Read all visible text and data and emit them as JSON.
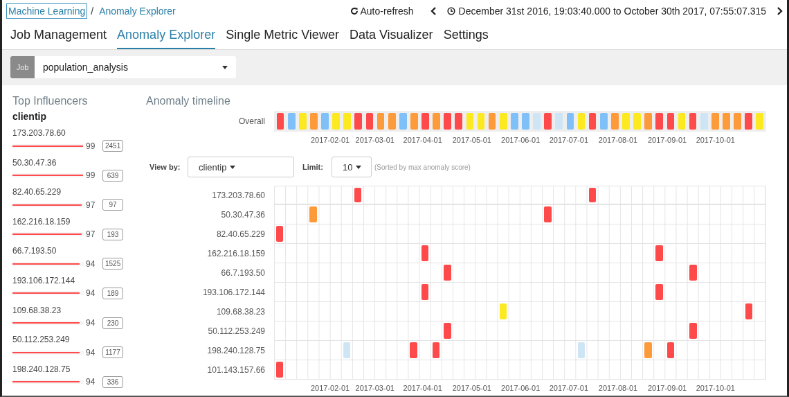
{
  "breadcrumbs": [
    {
      "label": "Machine Learning",
      "focused": true
    },
    {
      "label": "Anomaly Explorer",
      "focused": false
    }
  ],
  "breadcrumb_separator": "/",
  "toolbar": {
    "refresh": "Auto-refresh",
    "time_range": "December 31st 2016, 19:03:40.000 to October 30th 2017, 07:55:07.315"
  },
  "tabs": [
    {
      "label": "Job Management",
      "selected": false
    },
    {
      "label": "Anomaly Explorer",
      "selected": true
    },
    {
      "label": "Single Metric Viewer",
      "selected": false
    },
    {
      "label": "Data Visualizer",
      "selected": false
    },
    {
      "label": "Settings",
      "selected": false
    }
  ],
  "job": {
    "label": "Job",
    "value": "population_analysis"
  },
  "influencers": {
    "title": "Top Influencers",
    "field": "clientip",
    "items": [
      {
        "name": "173.203.78.60",
        "score": "99",
        "level": 0.99,
        "count": "2451"
      },
      {
        "name": "50.30.47.36",
        "score": "99",
        "level": 0.99,
        "count": "639"
      },
      {
        "name": "82.40.65.229",
        "score": "97",
        "level": 0.97,
        "count": "97"
      },
      {
        "name": "162.216.18.159",
        "score": "97",
        "level": 0.97,
        "count": "193"
      },
      {
        "name": "66.7.193.50",
        "score": "94",
        "level": 0.94,
        "count": "1525"
      },
      {
        "name": "193.106.172.144",
        "score": "94",
        "level": 0.94,
        "count": "189"
      },
      {
        "name": "109.68.38.23",
        "score": "94",
        "level": 0.94,
        "count": "230"
      },
      {
        "name": "50.112.253.249",
        "score": "94",
        "level": 0.94,
        "count": "1177"
      },
      {
        "name": "198.240.128.75",
        "score": "94",
        "level": 0.94,
        "count": "336"
      }
    ]
  },
  "timeline": {
    "title": "Anomaly timeline",
    "overall_label": "Overall",
    "overall": [
      {
        "color": "#fe4a4a"
      },
      {
        "color": "#80c0f8"
      },
      {
        "color": "#fde91f"
      },
      {
        "color": "#fd9a3a"
      },
      {
        "color": "#80c0f8"
      },
      {
        "color": "#fde91f"
      },
      {
        "color": "#fde91f"
      },
      {
        "color": "#fe4a4a"
      },
      {
        "color": "#fe4a4a"
      },
      {
        "color": "#fd9a3a"
      },
      {
        "color": "#fd9a3a"
      },
      {
        "color": "#80c0f8"
      },
      {
        "color": "#fd9a3a"
      },
      {
        "color": "#fe4a4a"
      },
      {
        "color": "#fd9a3a"
      },
      {
        "color": "#fe4a4a"
      },
      {
        "color": "#fe4a4a"
      },
      {
        "color": "#fde91f"
      },
      {
        "color": "#fde91f"
      },
      {
        "color": "#fd9a3a"
      },
      {
        "color": "#fde91f"
      },
      {
        "color": "#80c0f8"
      },
      {
        "color": "#80c0f8"
      },
      {
        "color": "#cde5f5"
      },
      {
        "color": "#fe4a4a"
      },
      {
        "color": "#cde5f5"
      },
      {
        "color": "#80c0f8"
      },
      {
        "color": "#fde91f"
      },
      {
        "color": "#fe4a4a"
      },
      {
        "color": "#80c0f8"
      },
      {
        "color": "#fd9a3a"
      },
      {
        "color": "#fde91f"
      },
      {
        "color": "#fde91f"
      },
      {
        "color": "#fd9a3a"
      },
      {
        "color": "#fe4a4a"
      },
      {
        "color": "#fe4a4a"
      },
      {
        "color": "#fde91f"
      },
      {
        "color": "#fe4a4a"
      },
      {
        "color": "#cde5f5"
      },
      {
        "color": "#fd9a3a"
      },
      {
        "color": "#fd9a3a"
      },
      {
        "color": "#fd9a3a"
      },
      {
        "color": "#fe4a4a"
      },
      {
        "color": "#fde91f"
      }
    ],
    "axis": [
      "2017-02-01",
      "2017-03-01",
      "2017-04-01",
      "2017-05-01",
      "2017-06-01",
      "2017-07-01",
      "2017-08-01",
      "2017-09-01",
      "2017-10-01"
    ],
    "view_by": {
      "label": "View by:",
      "value": "clientip"
    },
    "limit": {
      "label": "Limit:",
      "value": "10"
    },
    "sort_note": "(Sorted by max anomaly score)",
    "rows": [
      {
        "label": "173.203.78.60",
        "cells": [
          null,
          null,
          null,
          null,
          null,
          null,
          null,
          {
            "color": "#fe4a4a"
          },
          null,
          null,
          null,
          null,
          null,
          null,
          null,
          null,
          null,
          null,
          null,
          null,
          null,
          null,
          null,
          null,
          null,
          null,
          null,
          null,
          {
            "color": "#fe4a4a"
          },
          null,
          null,
          null,
          null,
          null,
          null,
          null,
          null,
          null,
          null,
          null,
          null,
          null,
          null,
          null
        ]
      },
      {
        "label": "50.30.47.36",
        "cells": [
          null,
          null,
          null,
          {
            "color": "#fd9a3a"
          },
          null,
          null,
          null,
          null,
          null,
          null,
          null,
          null,
          null,
          null,
          null,
          null,
          null,
          null,
          null,
          null,
          null,
          null,
          null,
          null,
          {
            "color": "#fe4a4a"
          },
          null,
          null,
          null,
          null,
          null,
          null,
          null,
          null,
          null,
          null,
          null,
          null,
          null,
          null,
          null,
          null,
          null,
          null,
          null
        ]
      },
      {
        "label": "82.40.65.229",
        "cells": [
          {
            "color": "#fe4a4a"
          },
          null,
          null,
          null,
          null,
          null,
          null,
          null,
          null,
          null,
          null,
          null,
          null,
          null,
          null,
          null,
          null,
          null,
          null,
          null,
          null,
          null,
          null,
          null,
          null,
          null,
          null,
          null,
          null,
          null,
          null,
          null,
          null,
          null,
          null,
          null,
          null,
          null,
          null,
          null,
          null,
          null,
          null,
          null
        ]
      },
      {
        "label": "162.216.18.159",
        "cells": [
          null,
          null,
          null,
          null,
          null,
          null,
          null,
          null,
          null,
          null,
          null,
          null,
          null,
          {
            "color": "#fe4a4a"
          },
          null,
          null,
          null,
          null,
          null,
          null,
          null,
          null,
          null,
          null,
          null,
          null,
          null,
          null,
          null,
          null,
          null,
          null,
          null,
          null,
          {
            "color": "#fe4a4a"
          },
          null,
          null,
          null,
          null,
          null,
          null,
          null,
          null,
          null
        ]
      },
      {
        "label": "66.7.193.50",
        "cells": [
          null,
          null,
          null,
          null,
          null,
          null,
          null,
          null,
          null,
          null,
          null,
          null,
          null,
          null,
          null,
          {
            "color": "#fe4a4a"
          },
          null,
          null,
          null,
          null,
          null,
          null,
          null,
          null,
          null,
          null,
          null,
          null,
          null,
          null,
          null,
          null,
          null,
          null,
          null,
          null,
          null,
          {
            "color": "#fe4a4a"
          },
          null,
          null,
          null,
          null,
          null,
          null
        ]
      },
      {
        "label": "193.106.172.144",
        "cells": [
          null,
          null,
          null,
          null,
          null,
          null,
          null,
          null,
          null,
          null,
          null,
          null,
          null,
          {
            "color": "#fe4a4a"
          },
          null,
          null,
          null,
          null,
          null,
          null,
          null,
          null,
          null,
          null,
          null,
          null,
          null,
          null,
          null,
          null,
          null,
          null,
          null,
          null,
          {
            "color": "#fe4a4a"
          },
          null,
          null,
          null,
          null,
          null,
          null,
          null,
          null,
          null
        ]
      },
      {
        "label": "109.68.38.23",
        "cells": [
          null,
          null,
          null,
          null,
          null,
          null,
          null,
          null,
          null,
          null,
          null,
          null,
          null,
          null,
          null,
          null,
          null,
          null,
          null,
          null,
          {
            "color": "#fde91f"
          },
          null,
          null,
          null,
          null,
          null,
          null,
          null,
          null,
          null,
          null,
          null,
          null,
          null,
          null,
          null,
          null,
          null,
          null,
          null,
          null,
          null,
          {
            "color": "#fe4a4a"
          },
          null
        ]
      },
      {
        "label": "50.112.253.249",
        "cells": [
          null,
          null,
          null,
          null,
          null,
          null,
          null,
          null,
          null,
          null,
          null,
          null,
          null,
          null,
          null,
          {
            "color": "#fe4a4a"
          },
          null,
          null,
          null,
          null,
          null,
          null,
          null,
          null,
          null,
          null,
          null,
          null,
          null,
          null,
          null,
          null,
          null,
          null,
          null,
          null,
          null,
          {
            "color": "#fe4a4a"
          },
          null,
          null,
          null,
          null,
          null,
          null
        ]
      },
      {
        "label": "198.240.128.75",
        "cells": [
          null,
          null,
          null,
          null,
          null,
          null,
          {
            "color": "#cde5f5"
          },
          null,
          null,
          null,
          null,
          null,
          {
            "color": "#fe4a4a"
          },
          null,
          {
            "color": "#fe4a4a"
          },
          null,
          null,
          null,
          null,
          null,
          null,
          null,
          null,
          null,
          null,
          null,
          null,
          {
            "color": "#cde5f5"
          },
          null,
          null,
          null,
          null,
          null,
          {
            "color": "#fd9a3a"
          },
          null,
          {
            "color": "#fe4a4a"
          },
          null,
          null,
          null,
          null,
          null,
          null,
          null,
          null
        ]
      },
      {
        "label": "101.143.157.66",
        "cells": [
          {
            "color": "#fe4a4a"
          },
          null,
          null,
          null,
          null,
          null,
          null,
          null,
          null,
          null,
          null,
          null,
          null,
          null,
          null,
          null,
          null,
          null,
          null,
          null,
          null,
          null,
          null,
          null,
          null,
          null,
          null,
          null,
          null,
          null,
          null,
          null,
          null,
          null,
          null,
          null,
          null,
          null,
          null,
          null,
          null,
          null,
          null,
          null
        ]
      }
    ],
    "axis_bottom": [
      "2017-02-01",
      "2017-03-01",
      "2017-04-01",
      "2017-05-01",
      "2017-06-01",
      "2017-07-01",
      "2017-08-01",
      "2017-09-01",
      "2017-10-01"
    ]
  }
}
